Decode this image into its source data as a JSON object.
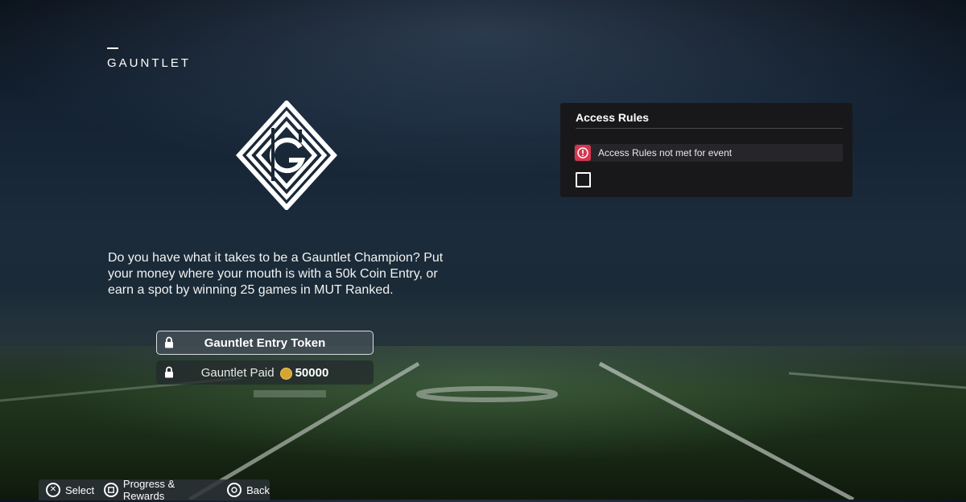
{
  "header": {
    "title": "GAUNTLET"
  },
  "description": "Do you have what it takes to be a Gauntlet Champion? Put your money where your mouth is with a 50k Coin Entry, or earn a spot by winning 25 games in MUT Ranked.",
  "entries": {
    "token": {
      "label": "Gauntlet Entry Token",
      "icon": "lock-icon"
    },
    "paid": {
      "label": "Gauntlet Paid",
      "currency_icon": "coin-icon",
      "value": "50000",
      "icon": "lock-icon"
    }
  },
  "access_rules": {
    "title": "Access Rules",
    "warning": "Access Rules not met for event",
    "checkbox_checked": false,
    "warning_color": "#d6364f"
  },
  "footer": {
    "hints": [
      {
        "button": "cross-button-icon",
        "label": "Select"
      },
      {
        "button": "square-button-icon",
        "label": "Progress & Rewards"
      },
      {
        "button": "circle-button-icon",
        "label": "Back"
      }
    ]
  }
}
